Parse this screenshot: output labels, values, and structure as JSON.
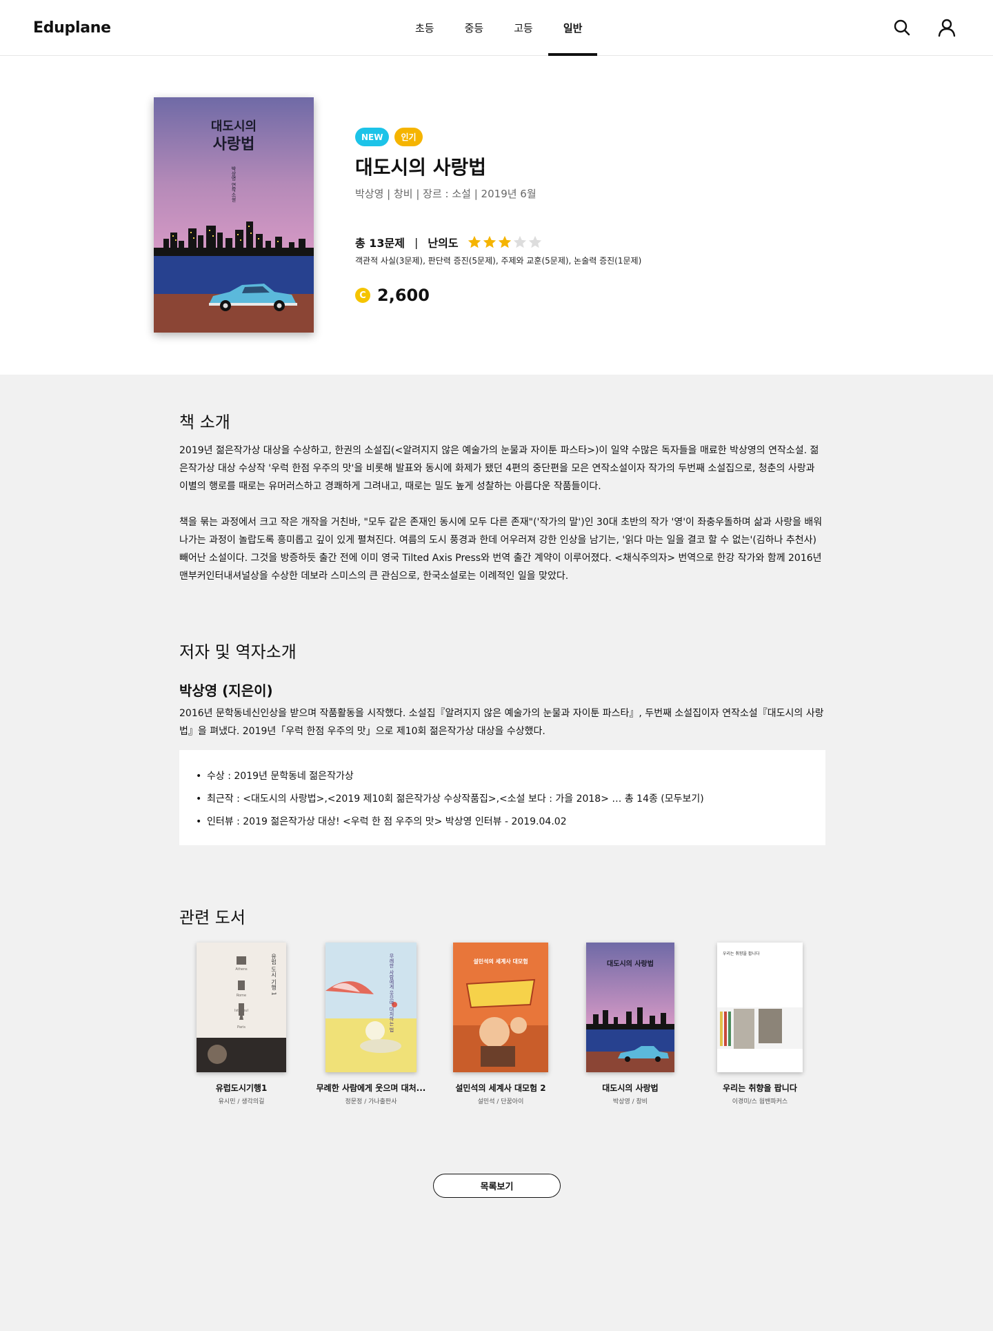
{
  "header": {
    "logo": "Eduplane",
    "nav": [
      "초등",
      "중등",
      "고등",
      "일반"
    ],
    "active_nav": "일반",
    "icons": [
      "search-icon",
      "user-icon"
    ]
  },
  "book": {
    "badges": [
      "NEW",
      "인기"
    ],
    "title": "대도시의 사랑법",
    "meta": "박상영 | 창비 | 장르 : 소설 | 2019년 6월",
    "questions": "총 13문제",
    "difficulty_label": "난의도",
    "difficulty_rating": 3,
    "difficulty_max": 5,
    "question_detail": "객관적 사실(3문제), 판단력 증진(5문제), 주제와 교훈(5문제), 논술력 증진(1문제)",
    "coin_symbol": "C",
    "price": "2,600",
    "cover": {
      "title_line1": "대도시의",
      "title_line2": "사랑법",
      "author_vertical": "박상영 연작소설"
    },
    "colors": {
      "new_badge": "#1cc3e8",
      "hot_badge": "#f5b400",
      "coin": "#f5c400",
      "star_on": "#f5b400",
      "star_off": "#dddddd"
    }
  },
  "intro": {
    "title": "책 소개",
    "p1": "2019년 젊은작가상 대상을 수상하고, 한권의 소설집(<알려지지 않은 예술가의 눈물과 자이툰 파스타>)이 일약 수많은 독자들을 매료한 박상영의 연작소설. 젊은작가상 대상 수상작 '우럭 한점 우주의 맛'을 비롯해 발표와 동시에 화제가 됐던 4편의 중단편을 모은 연작소설이자 작가의 두번째 소설집으로, 청춘의 사랑과 이별의 행로를 때로는 유머러스하고 경쾌하게 그려내고, 때로는 밀도 높게 성찰하는 아름다운 작품들이다.",
    "p2": "책을 묶는 과정에서 크고 작은 개작을 거친바, \"모두 같은 존재인 동시에 모두 다른 존재\"('작가의 말')인 30대 초반의 작가 '영'이 좌충우돌하며 삶과 사랑을 배워 나가는 과정이 놀랍도록 흥미롭고 깊이 있게 펼쳐진다. 여름의 도시 풍경과 한데 어우러져 강한 인상을 남기는, '읽다 마는 일을 결코 할 수 없는'(김하나 추천사) 빼어난 소설이다. 그것을 방증하듯 출간 전에 이미 영국 Tilted Axis Press와 번역 출간 계약이 이루어졌다. <채식주의자> 번역으로 한강 작가와 함께 2016년 맨부커인터내셔널상을 수상한 데보라 스미스의 큰 관심으로, 한국소설로는 이례적인 일을 맞았다."
  },
  "author": {
    "section_title": "저자 및 역자소개",
    "name": "박상영 (지은이)",
    "bio": "2016년 문학동네신인상을 받으며 작품활동을 시작했다. 소설집『알려지지 않은 예술가의 눈물과 자이툰 파스타』, 두번째 소설집이자 연작소설『대도시의 사랑법』을 펴냈다. 2019년「우럭 한점 우주의 맛」으로 제10회 젊은작가상 대상을 수상했다.",
    "facts": [
      "수상 : 2019년 문학동네 젊은작가상",
      "최근작 : <대도시의 사랑법>,<2019 제10회 젊은작가상 수상작품집>,<소설 보다 : 가을 2018> … 총 14종 (모두보기)",
      "인터뷰 : 2019 젊은작가상 대상! <우럭 한 점 우주의 맛> 박상영 인터뷰 - 2019.04.02"
    ]
  },
  "related": {
    "title": "관련 도서",
    "books": [
      {
        "title": "유럽도시기행1",
        "sub": "유시민 / 생각의길",
        "cover_text": "유럽 도시 기행 1",
        "cover_small": [
          "Athens",
          "Rome",
          "Istanbul",
          "Paris"
        ]
      },
      {
        "title": "무례한 사람에게 웃으며 대처...",
        "sub": "정문정 / 가나출판사",
        "cover_text": "무례한 사람에게 웃으며 대처하는 법"
      },
      {
        "title": "설민석의 세계사 대모험 2",
        "sub": "설민석 / 단꿈아이",
        "cover_text": "설민석의 세계사 대모험"
      },
      {
        "title": "대도시의 사랑법",
        "sub": "박상영 / 창비",
        "cover_text": "대도시의 사랑법"
      },
      {
        "title": "우리는 취향을 팝니다",
        "sub": "이경미/스 웜밴파커스",
        "cover_text": "우리는 취향을 팝니다"
      }
    ]
  },
  "list_button": "목록보기"
}
